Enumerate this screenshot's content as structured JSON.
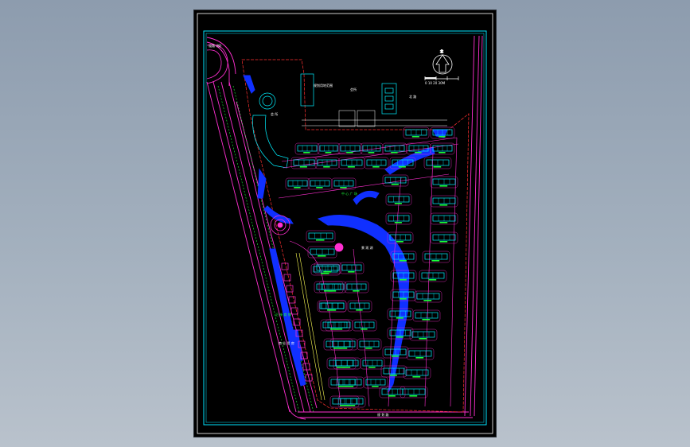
{
  "viewer": {
    "background_top": "#8d9cae",
    "background_bottom": "#b9c2cc"
  },
  "drawing": {
    "sheet_background": "#000000",
    "frame_color": "#ffffff",
    "border_color": "#00e5ff",
    "colors": {
      "road": "#ff2fd1",
      "building": "#00f0ff",
      "water": "#1030ff",
      "label": "#19ff3a",
      "boundary": "#ff3030",
      "path": "#ffff55",
      "text": "#ffffff"
    },
    "north_arrow_icon": "north-arrow-icon",
    "scale_bar_icon": "scale-bar-icon",
    "labels": {
      "top_left": "道路 (规)",
      "center_top": "规划用地范围",
      "center_top_2": "会所",
      "right_top": "北 路",
      "clubhouse": "会 所",
      "plaza": "中 心 广 场",
      "lake": "景 观 湖",
      "south_street": "规 划 路",
      "west_shops": "沿 街 商 铺",
      "west_shops_2": "商 业 用 房",
      "scale_text": "0   10   20   30M"
    }
  }
}
